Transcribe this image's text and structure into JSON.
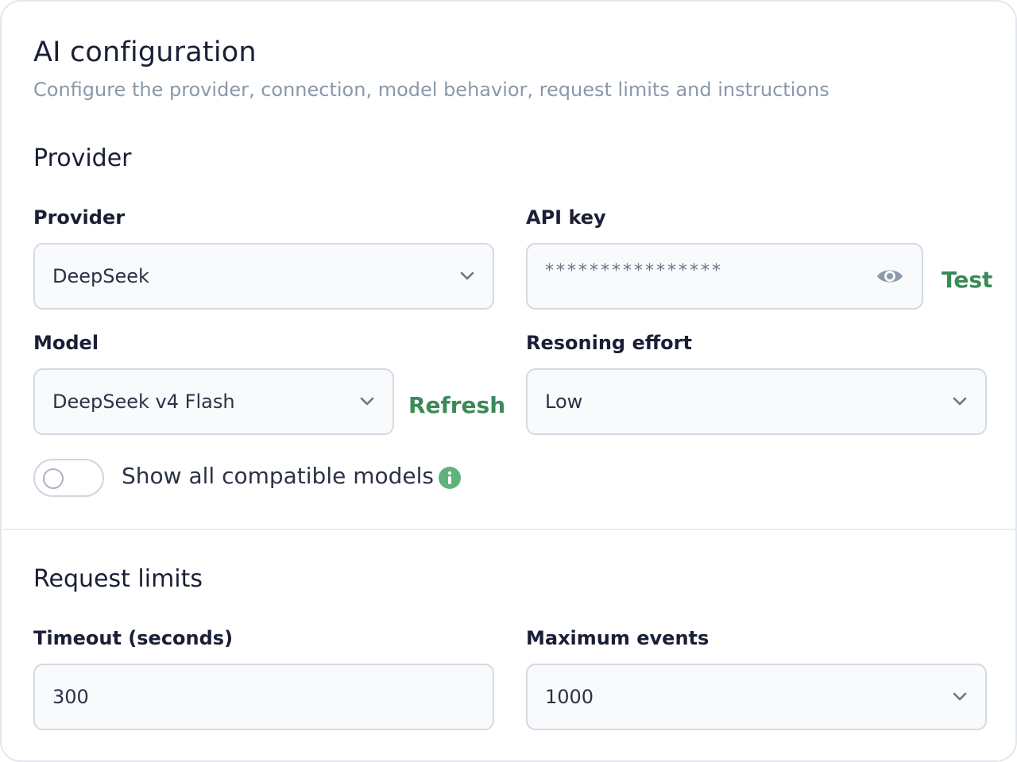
{
  "header": {
    "title": "AI configuration",
    "subtitle": "Configure the provider, connection, model behavior, request limits and instructions"
  },
  "provider_section": {
    "heading": "Provider",
    "provider": {
      "label": "Provider",
      "value": "DeepSeek"
    },
    "api_key": {
      "label": "API key",
      "value": "****************",
      "test_label": "Test"
    },
    "model": {
      "label": "Model",
      "value": "DeepSeek v4 Flash",
      "refresh_label": "Refresh"
    },
    "reasoning": {
      "label": "Resoning effort",
      "value": "Low"
    },
    "toggle": {
      "label": "Show all compatible models",
      "checked": false
    }
  },
  "limits_section": {
    "heading": "Request limits",
    "timeout": {
      "label": "Timeout (seconds)",
      "value": "300"
    },
    "max_events": {
      "label": "Maximum events",
      "value": "1000"
    }
  },
  "icons": {
    "chevron": "chevron-down-icon",
    "eye": "eye-icon",
    "info": "info-icon"
  },
  "colors": {
    "accent": "#3b8a58",
    "info_green": "#5fb37a",
    "muted_text": "#8a98aa",
    "border": "#d4dae2"
  }
}
